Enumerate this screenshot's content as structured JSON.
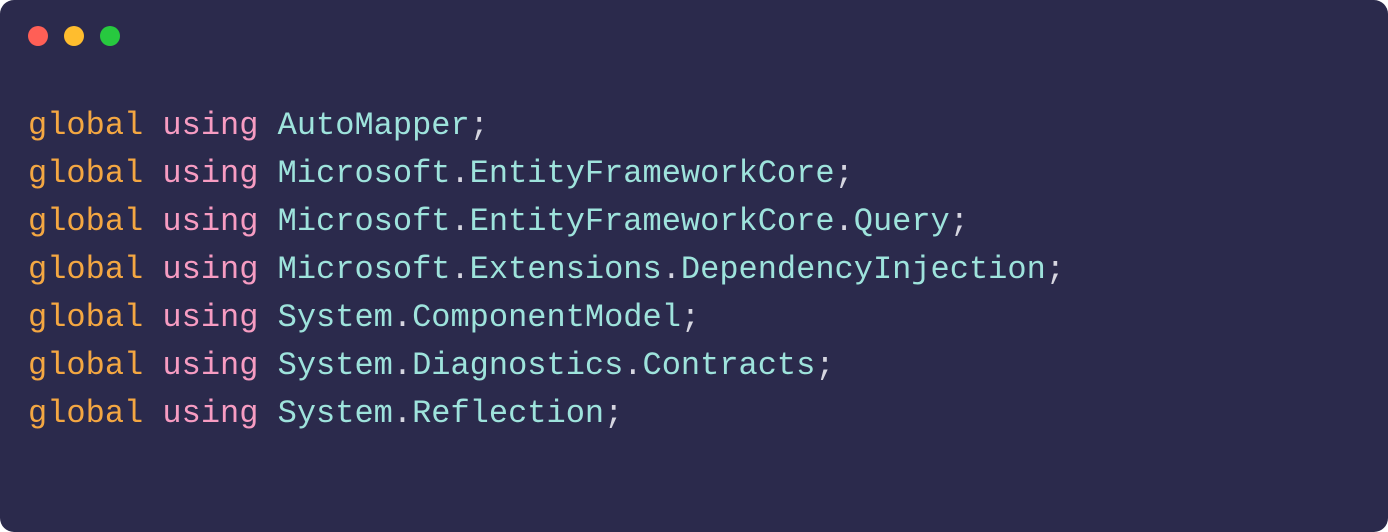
{
  "titlebar": {
    "dots": [
      "red",
      "yellow",
      "green"
    ]
  },
  "code": {
    "keyword_global": "global",
    "keyword_using": "using",
    "lines": [
      {
        "namespace": "AutoMapper"
      },
      {
        "namespace": "Microsoft.EntityFrameworkCore"
      },
      {
        "namespace": "Microsoft.EntityFrameworkCore.Query"
      },
      {
        "namespace": "Microsoft.Extensions.DependencyInjection"
      },
      {
        "namespace": "System.ComponentModel"
      },
      {
        "namespace": "System.Diagnostics.Contracts"
      },
      {
        "namespace": "System.Reflection"
      }
    ]
  }
}
